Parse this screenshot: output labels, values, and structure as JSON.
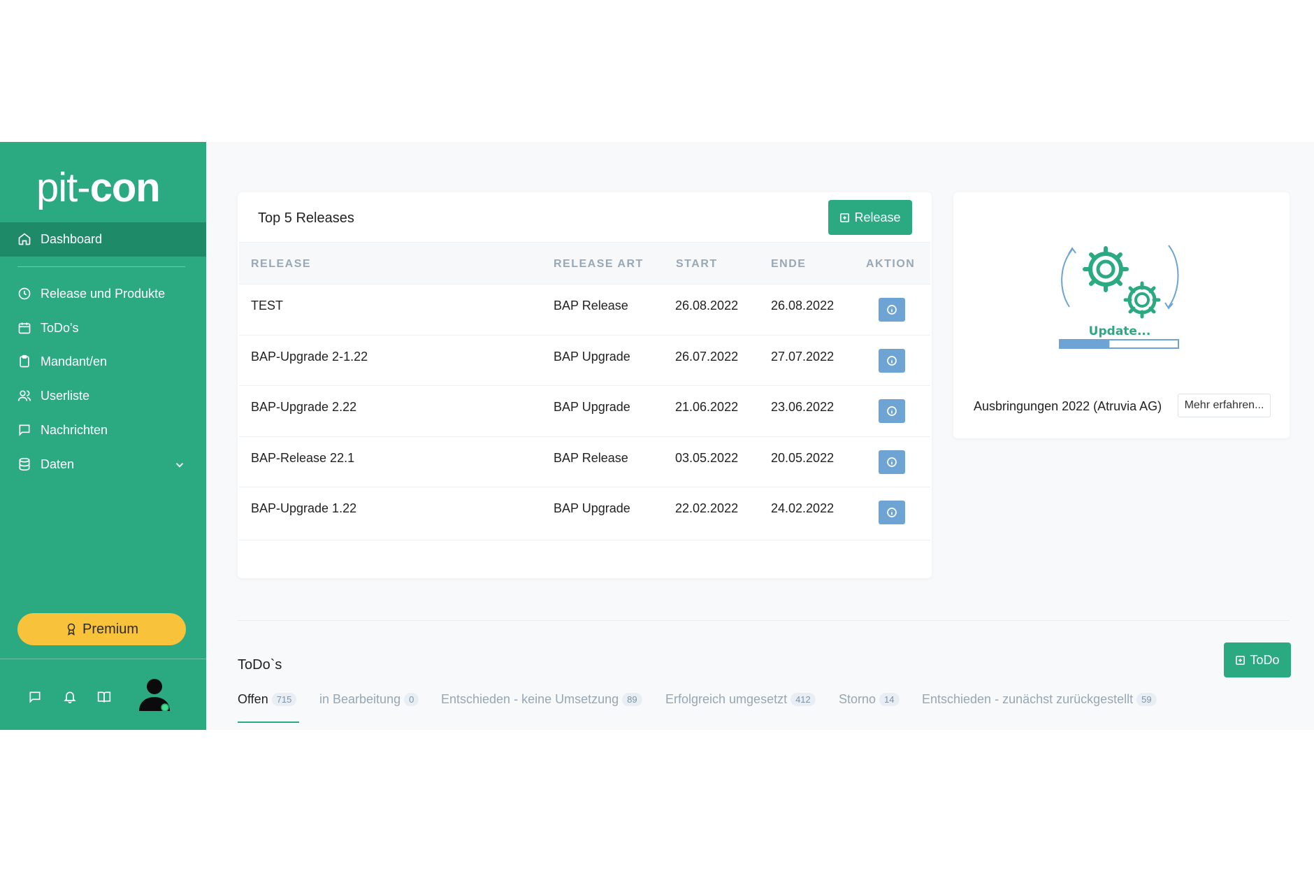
{
  "brand": {
    "light": "pit-",
    "bold": "con"
  },
  "sidebar": {
    "items": [
      {
        "label": "Dashboard",
        "icon": "home-icon"
      },
      {
        "label": "Release und Produkte",
        "icon": "clock-icon"
      },
      {
        "label": "ToDo's",
        "icon": "calendar-icon"
      },
      {
        "label": "Mandant/en",
        "icon": "clipboard-icon"
      },
      {
        "label": "Userliste",
        "icon": "users-icon"
      },
      {
        "label": "Nachrichten",
        "icon": "message-icon"
      },
      {
        "label": "Daten",
        "icon": "database-icon"
      }
    ],
    "premium_label": "Premium"
  },
  "releases": {
    "title": "Top 5 Releases",
    "add_label": "Release",
    "columns": [
      "RELEASE",
      "RELEASE ART",
      "START",
      "ENDE",
      "AKTION"
    ],
    "rows": [
      {
        "name": "TEST",
        "type": "BAP Release",
        "start": "26.08.2022",
        "end": "26.08.2022"
      },
      {
        "name": "BAP-Upgrade 2-1.22",
        "type": "BAP Upgrade",
        "start": "26.07.2022",
        "end": "27.07.2022"
      },
      {
        "name": "BAP-Upgrade 2.22",
        "type": "BAP Upgrade",
        "start": "21.06.2022",
        "end": "23.06.2022"
      },
      {
        "name": "BAP-Release 22.1",
        "type": "BAP Release",
        "start": "03.05.2022",
        "end": "20.05.2022"
      },
      {
        "name": "BAP-Upgrade 1.22",
        "type": "BAP Upgrade",
        "start": "22.02.2022",
        "end": "24.02.2022"
      }
    ]
  },
  "update_card": {
    "image_label": "Update...",
    "progress": 0.42,
    "text": "Ausbringungen 2022 (Atruvia AG)",
    "more_label": "Mehr erfahren..."
  },
  "todos": {
    "title": "ToDo`s",
    "add_label": "ToDo",
    "tabs": [
      {
        "label": "Offen",
        "count": "715"
      },
      {
        "label": "in Bearbeitung",
        "count": "0"
      },
      {
        "label": "Entschieden - keine Umsetzung",
        "count": "89"
      },
      {
        "label": "Erfolgreich umgesetzt",
        "count": "412"
      },
      {
        "label": "Storno",
        "count": "14"
      },
      {
        "label": "Entschieden - zunächst zurückgestellt",
        "count": "59"
      }
    ]
  },
  "colors": {
    "accent": "#2baa82",
    "accent_dark": "#1e8a68",
    "premium": "#f8c23a",
    "info": "#6ea4d4"
  }
}
